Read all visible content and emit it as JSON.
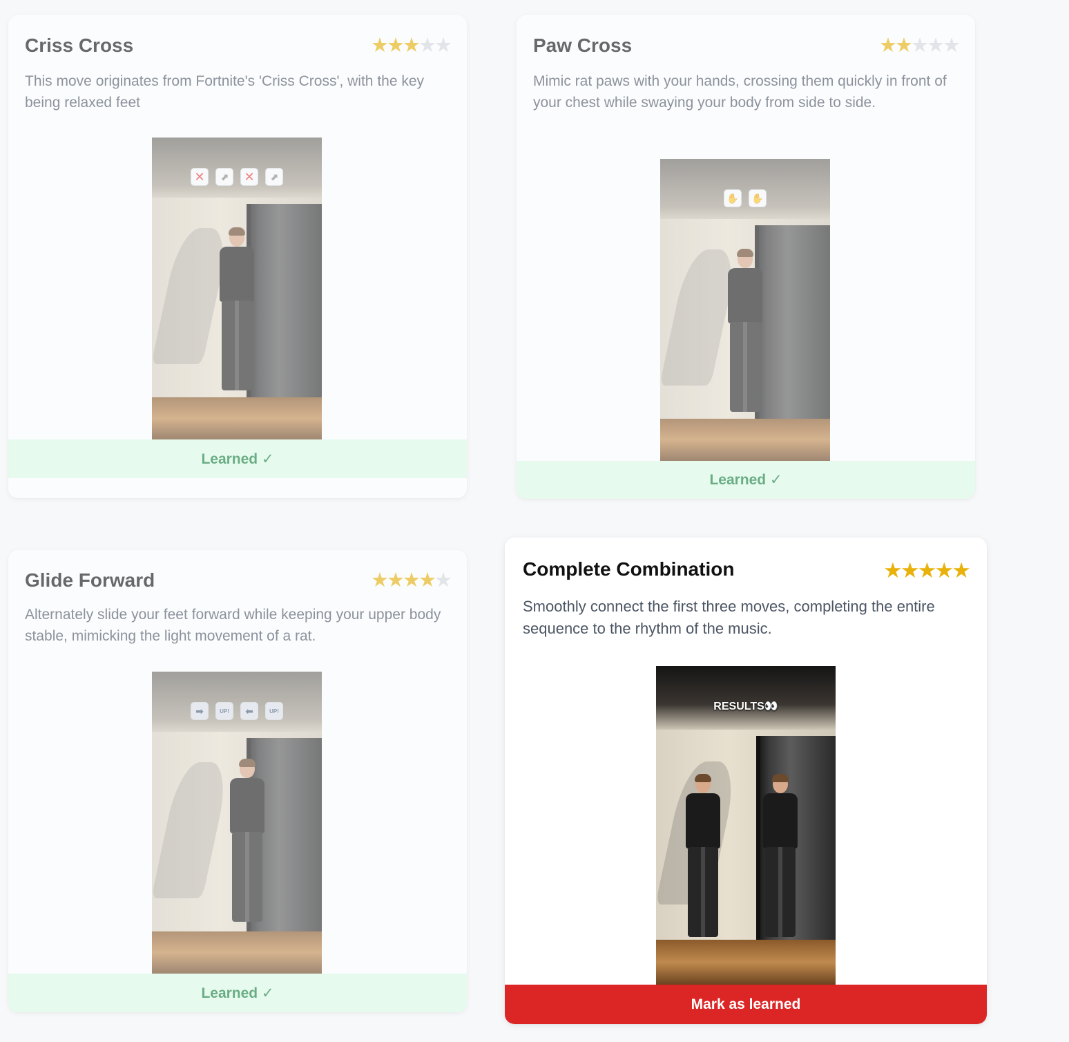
{
  "cards": [
    {
      "title": "Criss Cross",
      "rating": 3,
      "max_rating": 5,
      "description": "This move originates from Fortnite's 'Criss Cross', with the key being relaxed feet",
      "video_icons": [
        "cross-mark-icon",
        "shoe-icon",
        "cross-mark-icon",
        "shoe-icon"
      ],
      "status": "Learned ✓",
      "learned": true
    },
    {
      "title": "Paw Cross",
      "rating": 2,
      "max_rating": 5,
      "description": "Mimic rat paws with your hands, crossing them quickly in front of your chest while swaying your body from side to side.",
      "video_icons": [
        "hand-right-icon",
        "hand-left-icon"
      ],
      "status": "Learned ✓",
      "learned": true
    },
    {
      "title": "Glide Forward",
      "rating": 4,
      "max_rating": 5,
      "description": "Alternately slide your feet forward while keeping your upper body stable, mimicking the light movement of a rat.",
      "video_icons": [
        "arrow-right-icon",
        "up-button-icon",
        "arrow-left-icon",
        "up-button-icon"
      ],
      "status": "Learned ✓",
      "learned": true
    },
    {
      "title": "Complete Combination",
      "rating": 5,
      "max_rating": 5,
      "description": "Smoothly connect the first three moves, completing the entire sequence to the rhythm of the music.",
      "video_overlay_text": "RESULTS👀",
      "status": "Mark as learned",
      "learned": false
    }
  ],
  "colors": {
    "star_on": "#e8b20b",
    "star_off": "#d4d8de",
    "learned_bg": "#dcfce7",
    "learned_text": "#15803d",
    "mark_button_bg": "#dc2626"
  }
}
